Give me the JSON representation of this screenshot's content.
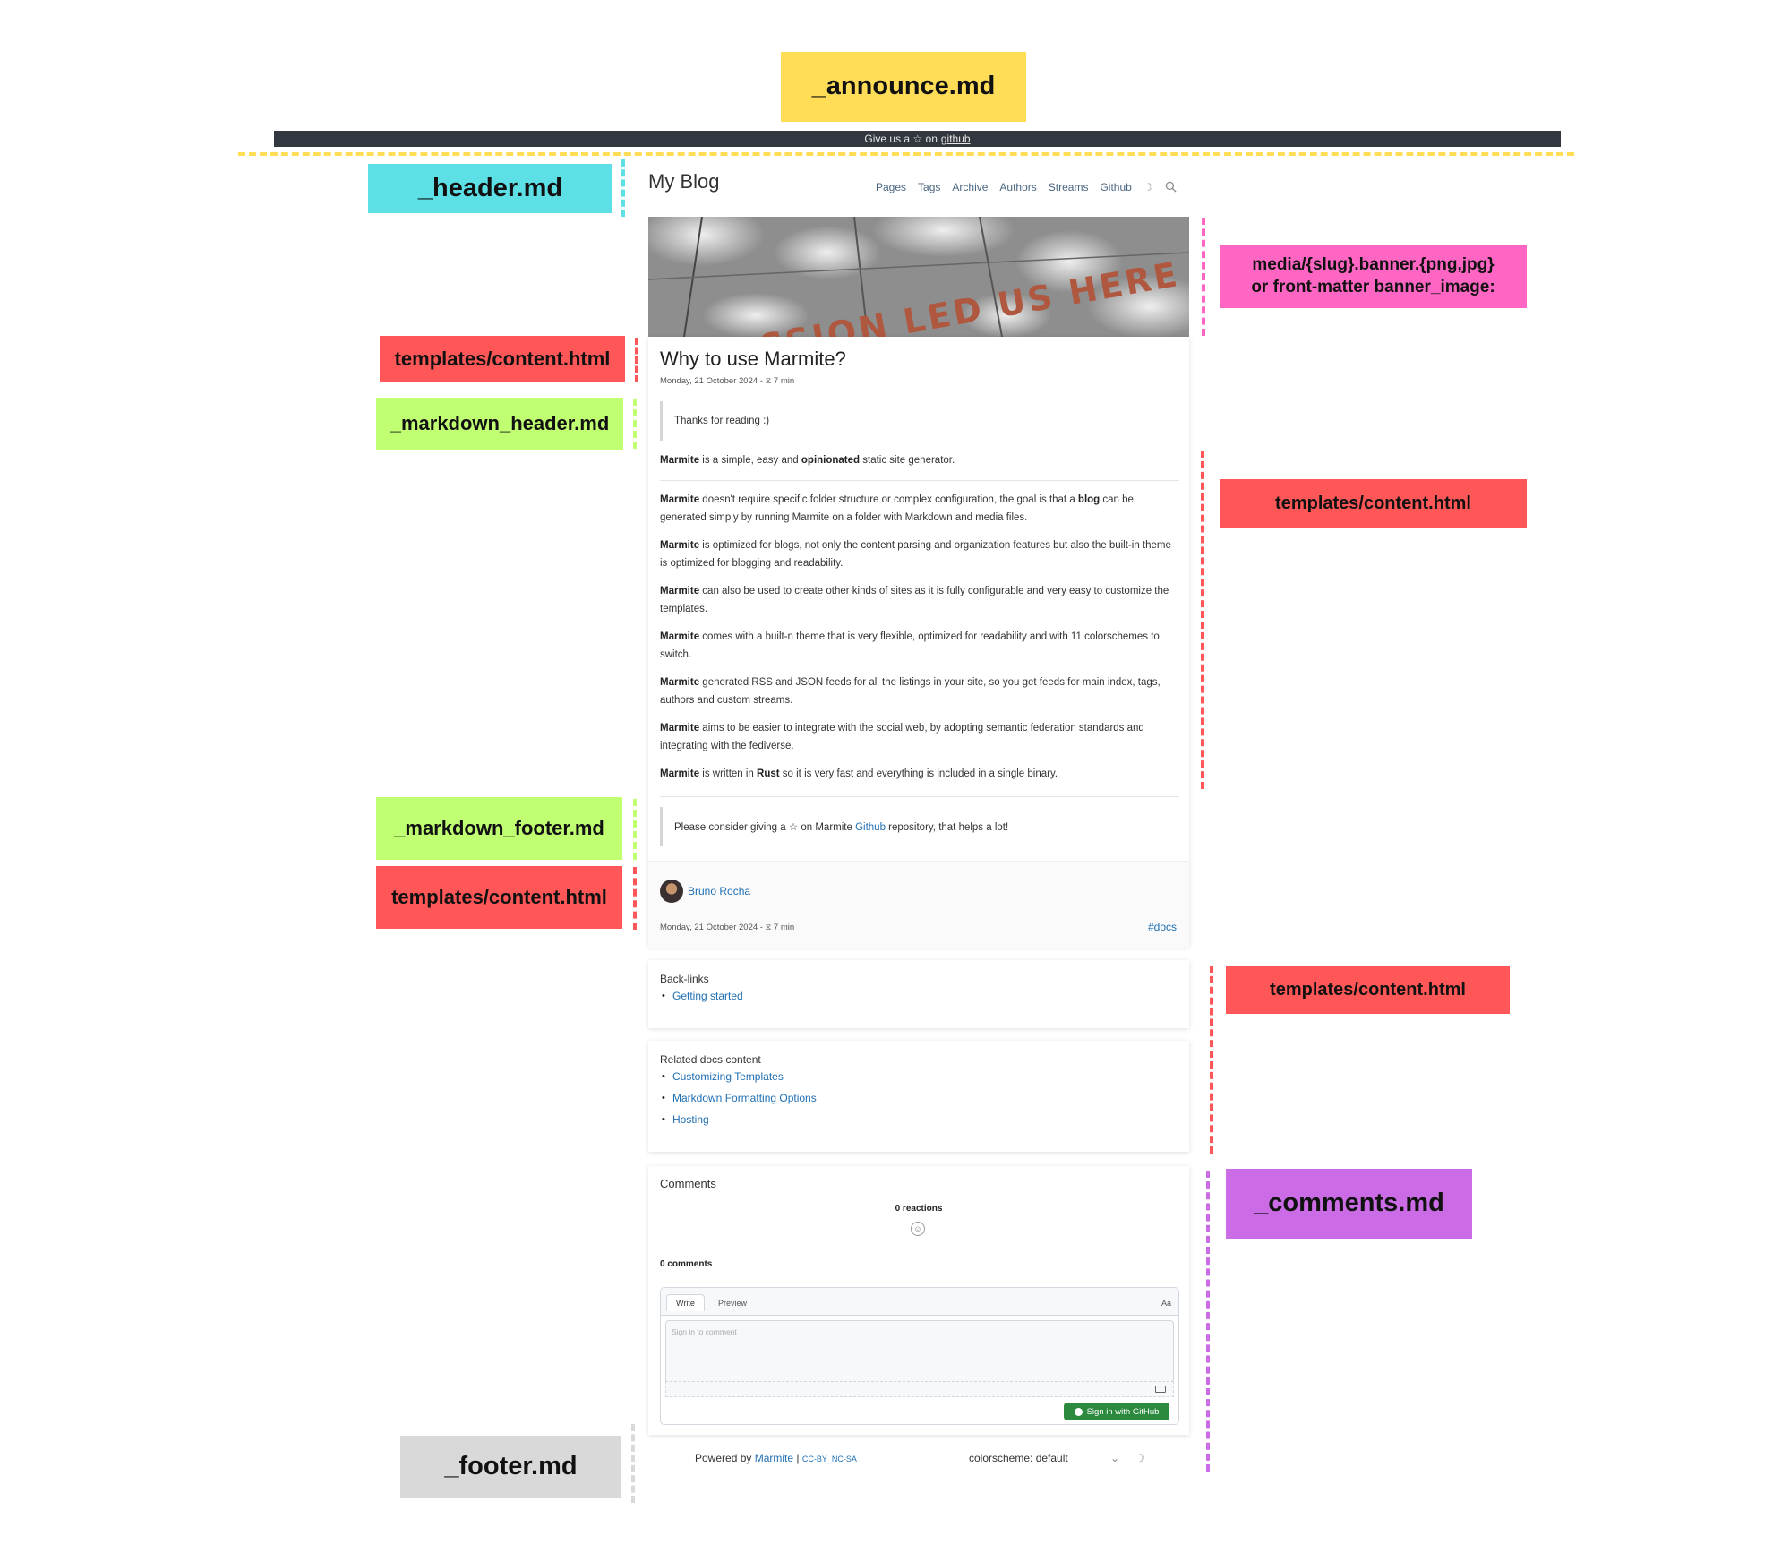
{
  "annotations": {
    "announce": "_announce.md",
    "header": "_header.md",
    "banner_line1": "media/{slug}.banner.{png,jpg}",
    "banner_line2": "or front-matter banner_image:",
    "content_title": "templates/content.html",
    "markdown_header": "_markdown_header.md",
    "content_body": "templates/content.html",
    "markdown_footer": "_markdown_footer.md",
    "content_author": "templates/content.html",
    "content_links": "templates/content.html",
    "comments": "_comments.md",
    "footer": "_footer.md"
  },
  "colors": {
    "announce_label": "#ffdd57",
    "header_label": "#5ce0e6",
    "banner_label": "#ff66c4",
    "template_label": "#ff5757",
    "markdown_label": "#c1ff72",
    "comments_label": "#cb6ce6",
    "footer_label": "#d9d9d9"
  },
  "announce_bar": {
    "text": "Give us a ☆ on",
    "link": "github"
  },
  "site": {
    "title": "My Blog",
    "nav": [
      "Pages",
      "Tags",
      "Archive",
      "Authors",
      "Streams",
      "Github"
    ],
    "theme_icon": "☽",
    "search_icon": "search-icon"
  },
  "banner": {
    "text": "PASSION LED US HERE"
  },
  "post": {
    "title": "Why to use Marmite?",
    "meta": "Monday, 21 October 2024 - ⧖ 7 min",
    "markdown_header_quote": "Thanks for reading :)",
    "intro": {
      "a": "Marmite",
      "b": " is a simple, easy and ",
      "c": "opinionated",
      "d": " static site generator."
    },
    "paragraphs": [
      {
        "bold": "Marmite",
        "text1": " doesn't require specific folder structure or complex configuration, the goal is that a ",
        "bold2": "blog",
        "text2": " can be generated simply by running Marmite on a folder with Markdown and media files."
      },
      {
        "bold": "Marmite",
        "text1": " is optimized for blogs, not only the content parsing and organization features but also the built-in theme is optimized for blogging and readability.",
        "bold2": "",
        "text2": ""
      },
      {
        "bold": "Marmite",
        "text1": " can also be used to create other kinds of sites as it is fully configurable and very easy to customize the templates.",
        "bold2": "",
        "text2": ""
      },
      {
        "bold": "Marmite",
        "text1": " comes with a built-n theme that is very flexible, optimized for readability and with 11 colorschemes to switch.",
        "bold2": "",
        "text2": ""
      },
      {
        "bold": "Marmite",
        "text1": " generated RSS and JSON feeds for all the listings in your site, so you get feeds for main index, tags, authors and custom streams.",
        "bold2": "",
        "text2": ""
      },
      {
        "bold": "Marmite",
        "text1": " aims to be easier to integrate with the social web, by adopting semantic federation standards and integrating with the fediverse.",
        "bold2": "",
        "text2": ""
      },
      {
        "bold": "Marmite",
        "text1": " is written in ",
        "bold2": "Rust",
        "text2": " so it is very fast and everything is included in a single binary."
      }
    ],
    "markdown_footer_quote": {
      "before": "Please consider giving a ☆ on Marmite ",
      "link": "Github",
      "after": " repository, that helps a lot!"
    },
    "author": "Bruno Rocha",
    "footer_meta": "Monday, 21 October 2024 - ⧖ 7 min",
    "tag": "#docs"
  },
  "backlinks": {
    "title": "Back-links",
    "items": [
      "Getting started"
    ]
  },
  "related": {
    "title": "Related docs content",
    "items": [
      "Customizing Templates",
      "Markdown Formatting Options",
      "Hosting"
    ]
  },
  "comments": {
    "title": "Comments",
    "reactions": "0 reactions",
    "count": "0 comments",
    "tab_write": "Write",
    "tab_preview": "Preview",
    "aa": "Aa",
    "placeholder": "Sign in to comment",
    "signin_button": "Sign in with GitHub"
  },
  "footer": {
    "powered_by": "Powered by",
    "marmite_link": "Marmite",
    "separator": "|",
    "license": "CC-BY_NC-SA",
    "colorscheme": "colorscheme: default",
    "chevron": "⌄",
    "moon": "☽"
  }
}
